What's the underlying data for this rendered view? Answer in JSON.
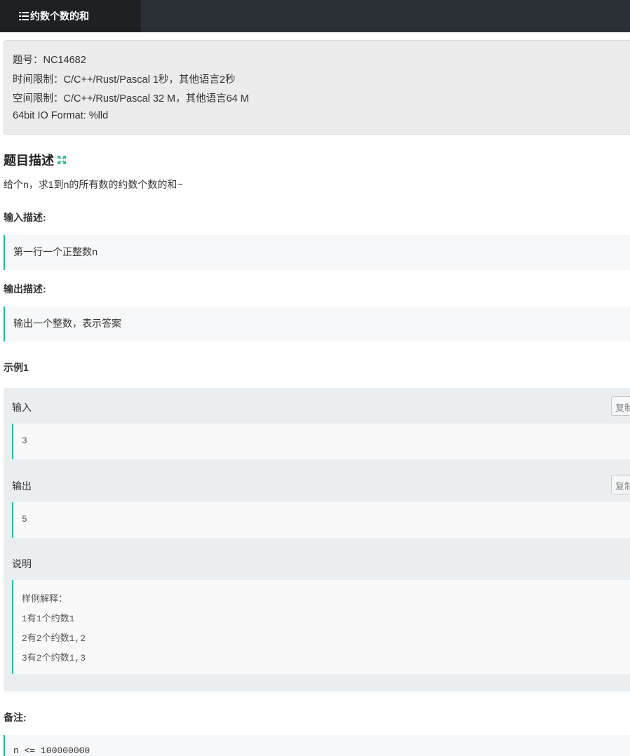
{
  "header": {
    "title": "约数个数的和"
  },
  "info": {
    "problem_id": "题号：NC14682",
    "time_limit": "时间限制：C/C++/Rust/Pascal 1秒，其他语言2秒",
    "space_limit": "空间限制：C/C++/Rust/Pascal 32 M，其他语言64 M",
    "io_format": "64bit IO Format: %lld"
  },
  "description": {
    "heading": "题目描述",
    "text": "给个n，求1到n的所有数的约数个数的和~"
  },
  "input_section": {
    "heading": "输入描述:",
    "text_cn": "第一行一个正整数",
    "text_var": "n"
  },
  "output_section": {
    "heading": "输出描述:",
    "text": "输出一个整数，表示答案"
  },
  "example": {
    "heading": "示例1",
    "input_label": "输入",
    "input_value": "3",
    "output_label": "输出",
    "output_value": "5",
    "copy_label": "复制",
    "explain_label": "说明",
    "explain_lines": [
      "样例解释：",
      "1有1个约数1",
      "2有2个约数1,2",
      "3有2个约数1,3"
    ]
  },
  "notes": {
    "heading": "备注:",
    "text": "n <= 100000000"
  },
  "colors": {
    "accent": "#25bb9b",
    "topbar": "#2a2f33",
    "tab": "#1d2124"
  },
  "icons": {
    "title_icon": "list-icon",
    "expand_icon": "expand-icon"
  }
}
